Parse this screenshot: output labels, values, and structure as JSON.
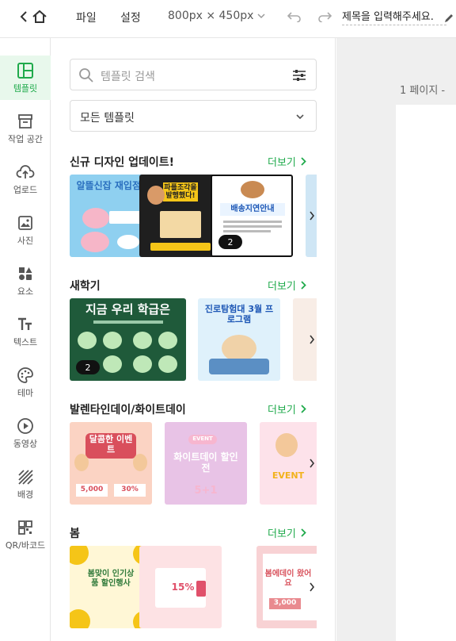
{
  "topbar": {
    "back_label": "<",
    "file_menu": "파일",
    "settings_menu": "설정",
    "canvas_size": "800px × 450px",
    "title_placeholder": "제목을 입력해주세요."
  },
  "rail": [
    {
      "label": "템플릿",
      "icon": "template-icon"
    },
    {
      "label": "작업 공간",
      "icon": "workspace-icon"
    },
    {
      "label": "업로드",
      "icon": "upload-icon"
    },
    {
      "label": "사진",
      "icon": "photo-icon"
    },
    {
      "label": "요소",
      "icon": "elements-icon"
    },
    {
      "label": "텍스트",
      "icon": "text-icon"
    },
    {
      "label": "테마",
      "icon": "theme-icon"
    },
    {
      "label": "동영상",
      "icon": "video-icon"
    },
    {
      "label": "배경",
      "icon": "background-icon"
    },
    {
      "label": "QR/바코드",
      "icon": "qr-icon"
    }
  ],
  "panel": {
    "search_placeholder": "템플릿 검색",
    "category_select": "모든 템플릿",
    "more_label": "더보기",
    "sections": [
      {
        "title": "신규 디자인 업데이트!",
        "thumbs": [
          {
            "text": "알뜰신잡 재입점!"
          },
          {
            "text": "파플조각을 발행했다!"
          },
          {
            "text": "배송지연안내",
            "badge": "2"
          }
        ]
      },
      {
        "title": "새학기",
        "thumbs": [
          {
            "text": "지금 우리 학급은",
            "badge": "2"
          },
          {
            "text": "진로탐험대 3월 프로그램"
          }
        ]
      },
      {
        "title": "발렌타인데이/화이트데이",
        "thumbs": [
          {
            "text": "달콤한 이벤트",
            "sub1": "5,000",
            "sub2": "30%"
          },
          {
            "text": "화이트데이 할인전",
            "sub1": "EVENT",
            "sub2": "5+1"
          },
          {
            "text": "EVENT"
          }
        ]
      },
      {
        "title": "봄",
        "thumbs": [
          {
            "text": "봄맞이 인기상품 할인행사"
          },
          {
            "text": "15%"
          },
          {
            "text": "봄에데이 왔어요",
            "sub1": "3,000"
          }
        ]
      }
    ]
  },
  "canvas": {
    "page_label": "1 페이지 -"
  },
  "colors": {
    "accent": "#1faa4b",
    "active_bg": "#e8f8ec"
  }
}
